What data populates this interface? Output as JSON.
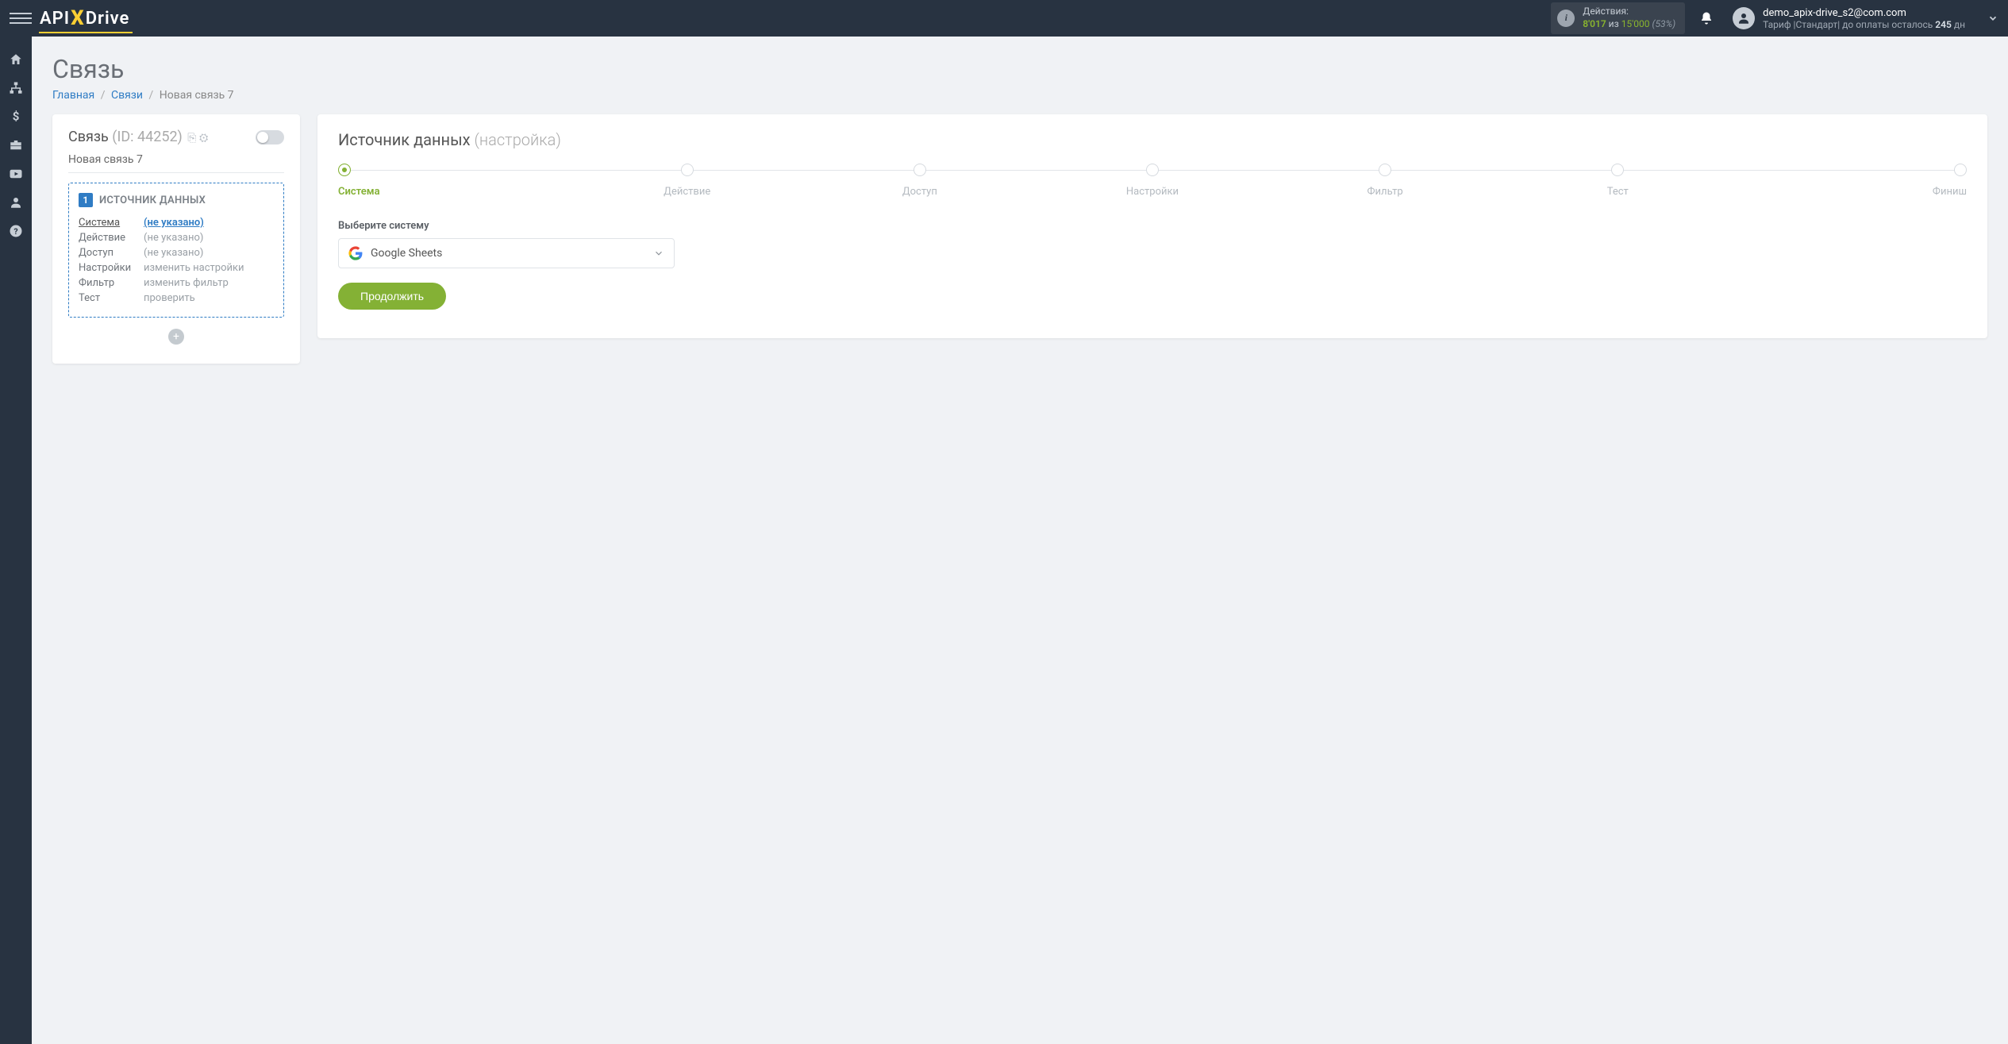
{
  "header": {
    "logo": {
      "api": "API",
      "x": "X",
      "drive": "Drive"
    },
    "actions": {
      "label": "Действия:",
      "used": "8'017",
      "of": "из",
      "total": "15'000",
      "percent": "(53%)"
    },
    "user": {
      "email": "demo_apix-drive_s2@com.com",
      "tariff_prefix": "Тариф |",
      "tariff_name": "Стандарт",
      "tariff_mid": "|  до оплаты осталось ",
      "days": "245",
      "days_suffix": " дн"
    }
  },
  "page": {
    "title": "Связь",
    "breadcrumb": {
      "home": "Главная",
      "links": "Связи",
      "current": "Новая связь 7"
    }
  },
  "left": {
    "title": "Связь",
    "id_label": "(ID: 44252)",
    "name": "Новая связь 7",
    "source": {
      "num": "1",
      "title": "ИСТОЧНИК ДАННЫХ",
      "rows": [
        {
          "k": "Система",
          "v": "(не указано)",
          "k_active": true,
          "v_link": true
        },
        {
          "k": "Действие",
          "v": "(не указано)",
          "k_active": false,
          "v_link": false
        },
        {
          "k": "Доступ",
          "v": "(не указано)",
          "k_active": false,
          "v_link": false
        },
        {
          "k": "Настройки",
          "v": "изменить настройки",
          "k_active": false,
          "v_link": false
        },
        {
          "k": "Фильтр",
          "v": "изменить фильтр",
          "k_active": false,
          "v_link": false
        },
        {
          "k": "Тест",
          "v": "проверить",
          "k_active": false,
          "v_link": false
        }
      ]
    },
    "add": "+"
  },
  "right": {
    "title": "Источник данных",
    "subtitle": "(настройка)",
    "steps": [
      "Система",
      "Действие",
      "Доступ",
      "Настройки",
      "Фильтр",
      "Тест",
      "Финиш"
    ],
    "active_step": 0,
    "field_label": "Выберите систему",
    "system_selected": "Google Sheets",
    "continue": "Продолжить"
  },
  "sidenav": [
    "home-icon",
    "sitemap-icon",
    "dollar-icon",
    "briefcase-icon",
    "youtube-icon",
    "user-icon",
    "help-icon"
  ]
}
